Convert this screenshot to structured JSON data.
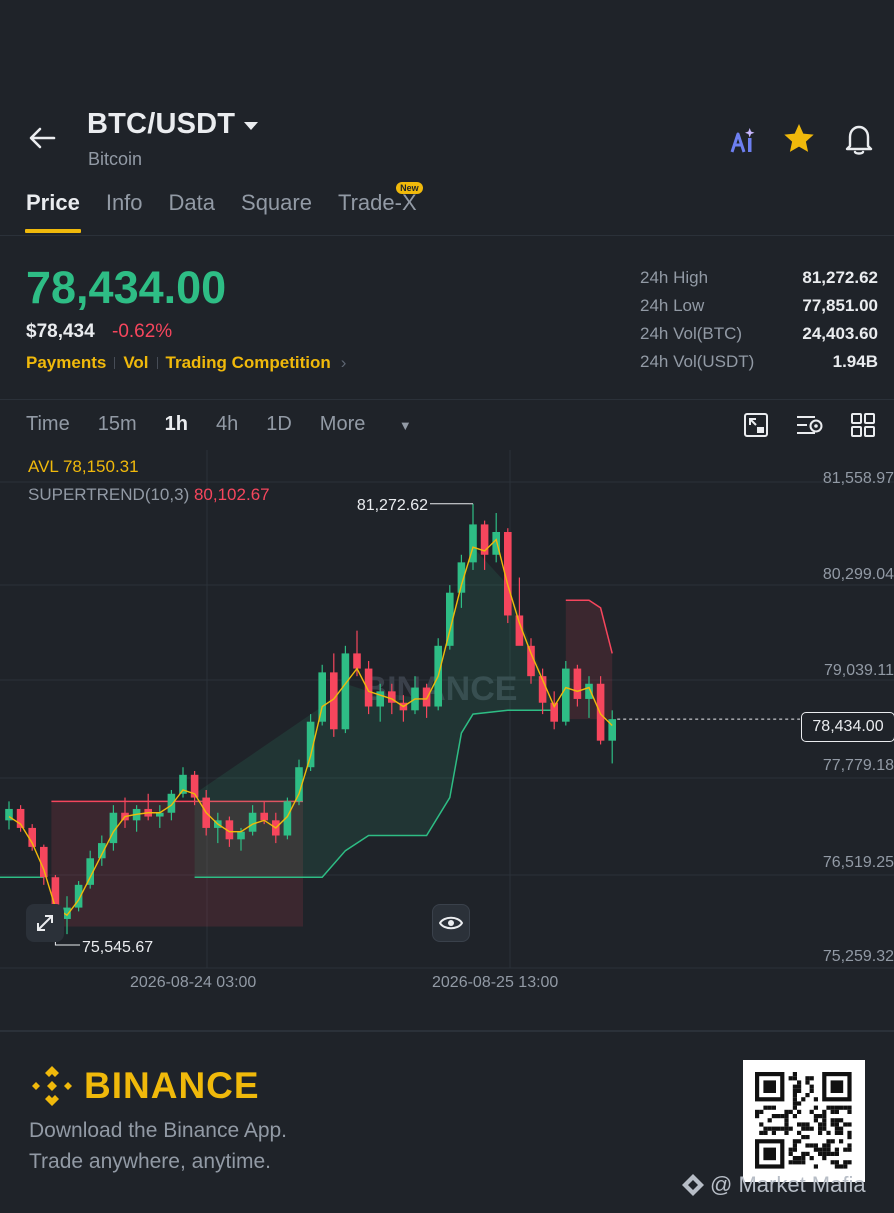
{
  "header": {
    "pair": "BTC/USDT",
    "subtitle": "Bitcoin",
    "icons": [
      "back-arrow-icon",
      "caret-down-icon",
      "ai-icon",
      "star-icon",
      "bell-icon"
    ]
  },
  "tabs": [
    {
      "label": "Price",
      "active": true
    },
    {
      "label": "Info"
    },
    {
      "label": "Data"
    },
    {
      "label": "Square"
    },
    {
      "label": "Trade-X",
      "badge": "New"
    }
  ],
  "price": {
    "last": "78,434.00",
    "usd": "$78,434",
    "change": "-0.62%",
    "links": [
      "Payments",
      "Vol",
      "Trading Competition"
    ]
  },
  "stats": [
    {
      "label": "24h High",
      "value": "81,272.62"
    },
    {
      "label": "24h Low",
      "value": "77,851.00"
    },
    {
      "label": "24h Vol(BTC)",
      "value": "24,403.60"
    },
    {
      "label": "24h Vol(USDT)",
      "value": "1.94B"
    }
  ],
  "intervals": [
    "Time",
    "15m",
    "1h",
    "4h",
    "1D",
    "More"
  ],
  "active_interval": "1h",
  "indicators": {
    "avl_label": "AVL 78,150.31",
    "supertrend_label": "SUPERTREND(10,3)",
    "supertrend_value": "80,102.67"
  },
  "chart_data": {
    "type": "candlestick",
    "y_ticks": [
      "81,558.97",
      "80,299.04",
      "79,039.11",
      "77,779.18",
      "76,519.25",
      "75,259.32"
    ],
    "x_ticks": [
      "2026-08-24 03:00",
      "2026-08-25 13:00"
    ],
    "ylim": [
      75259.32,
      81558.97
    ],
    "current_price": "78,434.00",
    "max_label": "81,272.62",
    "min_label": "75,545.67",
    "watermark": "BINANCE",
    "colors": {
      "up": "#2ebd85",
      "down": "#f6465d",
      "avl": "#f0b90b"
    },
    "candles": [
      [
        77100,
        77350,
        76980,
        77250
      ],
      [
        77250,
        77300,
        76950,
        77000
      ],
      [
        77000,
        77050,
        76700,
        76750
      ],
      [
        76750,
        76780,
        76250,
        76350
      ],
      [
        76350,
        76380,
        75546,
        75800
      ],
      [
        75800,
        76100,
        75600,
        75950
      ],
      [
        75950,
        76300,
        75900,
        76250
      ],
      [
        76250,
        76700,
        76200,
        76600
      ],
      [
        76600,
        76900,
        76500,
        76800
      ],
      [
        76800,
        77300,
        76700,
        77200
      ],
      [
        77200,
        77400,
        77000,
        77100
      ],
      [
        77100,
        77300,
        76950,
        77250
      ],
      [
        77250,
        77450,
        77100,
        77150
      ],
      [
        77150,
        77300,
        77000,
        77200
      ],
      [
        77200,
        77500,
        77100,
        77450
      ],
      [
        77450,
        77800,
        77400,
        77700
      ],
      [
        77700,
        77750,
        77300,
        77400
      ],
      [
        77400,
        77500,
        76900,
        77000
      ],
      [
        77000,
        77200,
        76800,
        77100
      ],
      [
        77100,
        77150,
        76750,
        76850
      ],
      [
        76850,
        77000,
        76700,
        76950
      ],
      [
        76950,
        77300,
        76900,
        77200
      ],
      [
        77200,
        77350,
        77050,
        77100
      ],
      [
        77100,
        77200,
        76800,
        76900
      ],
      [
        76900,
        77400,
        76850,
        77350
      ],
      [
        77350,
        77900,
        77300,
        77800
      ],
      [
        77800,
        78500,
        77750,
        78400
      ],
      [
        78400,
        79150,
        78350,
        79050
      ],
      [
        79050,
        79300,
        78200,
        78300
      ],
      [
        78300,
        79400,
        78250,
        79300
      ],
      [
        79300,
        79600,
        79000,
        79100
      ],
      [
        79100,
        79200,
        78500,
        78600
      ],
      [
        78600,
        78900,
        78400,
        78800
      ],
      [
        78800,
        78900,
        78500,
        78650
      ],
      [
        78650,
        78750,
        78400,
        78550
      ],
      [
        78550,
        79000,
        78500,
        78850
      ],
      [
        78850,
        78900,
        78450,
        78600
      ],
      [
        78600,
        79500,
        78550,
        79400
      ],
      [
        79400,
        80200,
        79350,
        80100
      ],
      [
        80100,
        80600,
        79900,
        80500
      ],
      [
        80500,
        81272,
        80400,
        81000
      ],
      [
        81000,
        81050,
        80400,
        80600
      ],
      [
        80600,
        81150,
        80500,
        80900
      ],
      [
        80900,
        80950,
        79700,
        79800
      ],
      [
        79800,
        80300,
        79500,
        79400
      ],
      [
        79400,
        79500,
        78900,
        79000
      ],
      [
        79000,
        79100,
        78500,
        78650
      ],
      [
        78650,
        78800,
        78300,
        78400
      ],
      [
        78400,
        79200,
        78350,
        79100
      ],
      [
        79100,
        79150,
        78600,
        78700
      ],
      [
        78700,
        79000,
        78450,
        78900
      ],
      [
        78900,
        79000,
        78100,
        78150
      ],
      [
        78150,
        78550,
        77850,
        78434
      ]
    ],
    "avl_line": [
      77150,
      77050,
      76800,
      76450,
      75950,
      75850,
      76050,
      76350,
      76650,
      76950,
      77150,
      77180,
      77200,
      77200,
      77300,
      77500,
      77450,
      77200,
      77050,
      76950,
      76950,
      77050,
      77100,
      77000,
      77150,
      77450,
      77950,
      78600,
      78700,
      78900,
      79100,
      78800,
      78750,
      78700,
      78600,
      78700,
      78700,
      79000,
      79600,
      80200,
      80700,
      80650,
      80800,
      80200,
      79700,
      79300,
      78950,
      78600,
      78850,
      78800,
      78850,
      78500,
      78350
    ],
    "supertrend_down": {
      "from": 4,
      "to": 25,
      "level": 77350
    },
    "supertrend_recent": {
      "from": 48,
      "values": [
        80000,
        80000,
        80000,
        79900,
        79300
      ]
    }
  },
  "footer": {
    "brand": "BINANCE",
    "line1": "Download the Binance App.",
    "line2": "Trade anywhere, anytime.",
    "watermark": "@ Market Mafia"
  }
}
